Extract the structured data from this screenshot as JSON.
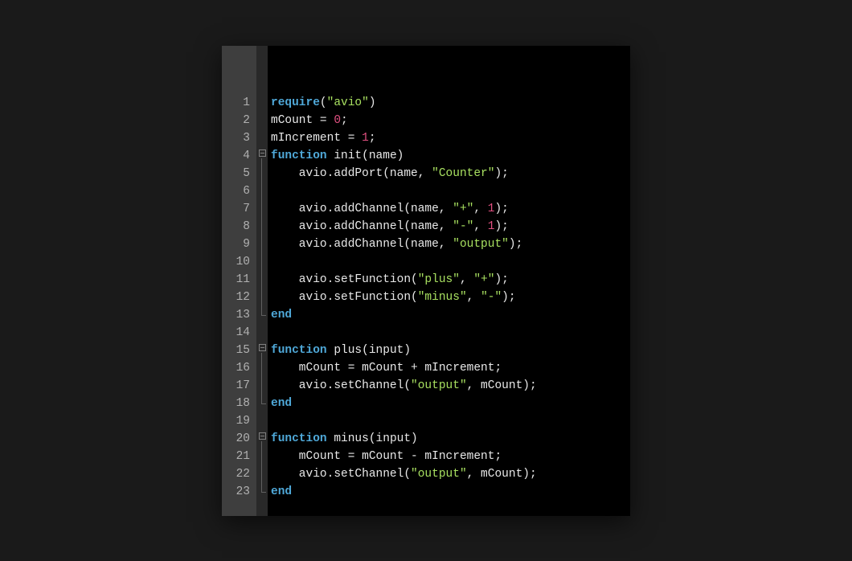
{
  "gutter": {
    "lines": [
      "1",
      "2",
      "3",
      "4",
      "5",
      "6",
      "7",
      "8",
      "9",
      "10",
      "11",
      "12",
      "13",
      "14",
      "15",
      "16",
      "17",
      "18",
      "19",
      "20",
      "21",
      "22",
      "23"
    ]
  },
  "code": {
    "lines": [
      [
        {
          "t": "keyword",
          "v": "require"
        },
        {
          "t": "punct",
          "v": "("
        },
        {
          "t": "string",
          "v": "\"avio\""
        },
        {
          "t": "punct",
          "v": ")"
        }
      ],
      [
        {
          "t": "ident",
          "v": "mCount = "
        },
        {
          "t": "number",
          "v": "0"
        },
        {
          "t": "punct",
          "v": ";"
        }
      ],
      [
        {
          "t": "ident",
          "v": "mIncrement = "
        },
        {
          "t": "number",
          "v": "1"
        },
        {
          "t": "punct",
          "v": ";"
        }
      ],
      [
        {
          "t": "keyword",
          "v": "function"
        },
        {
          "t": "ident",
          "v": " init(name)"
        }
      ],
      [
        {
          "t": "ident",
          "v": "    avio.addPort(name, "
        },
        {
          "t": "string",
          "v": "\"Counter\""
        },
        {
          "t": "punct",
          "v": ");"
        }
      ],
      [],
      [
        {
          "t": "ident",
          "v": "    avio.addChannel(name, "
        },
        {
          "t": "string",
          "v": "\"+\""
        },
        {
          "t": "punct",
          "v": ", "
        },
        {
          "t": "number",
          "v": "1"
        },
        {
          "t": "punct",
          "v": ");"
        }
      ],
      [
        {
          "t": "ident",
          "v": "    avio.addChannel(name, "
        },
        {
          "t": "string",
          "v": "\"-\""
        },
        {
          "t": "punct",
          "v": ", "
        },
        {
          "t": "number",
          "v": "1"
        },
        {
          "t": "punct",
          "v": ");"
        }
      ],
      [
        {
          "t": "ident",
          "v": "    avio.addChannel(name, "
        },
        {
          "t": "string",
          "v": "\"output\""
        },
        {
          "t": "punct",
          "v": ");"
        }
      ],
      [],
      [
        {
          "t": "ident",
          "v": "    avio.setFunction("
        },
        {
          "t": "string",
          "v": "\"plus\""
        },
        {
          "t": "punct",
          "v": ", "
        },
        {
          "t": "string",
          "v": "\"+\""
        },
        {
          "t": "punct",
          "v": ");"
        }
      ],
      [
        {
          "t": "ident",
          "v": "    avio.setFunction("
        },
        {
          "t": "string",
          "v": "\"minus\""
        },
        {
          "t": "punct",
          "v": ", "
        },
        {
          "t": "string",
          "v": "\"-\""
        },
        {
          "t": "punct",
          "v": ");"
        }
      ],
      [
        {
          "t": "keyword",
          "v": "end"
        }
      ],
      [],
      [
        {
          "t": "keyword",
          "v": "function"
        },
        {
          "t": "ident",
          "v": " plus(input)"
        }
      ],
      [
        {
          "t": "ident",
          "v": "    mCount = mCount + mIncrement;"
        }
      ],
      [
        {
          "t": "ident",
          "v": "    avio.setChannel("
        },
        {
          "t": "string",
          "v": "\"output\""
        },
        {
          "t": "punct",
          "v": ", mCount);"
        }
      ],
      [
        {
          "t": "keyword",
          "v": "end"
        }
      ],
      [],
      [
        {
          "t": "keyword",
          "v": "function"
        },
        {
          "t": "ident",
          "v": " minus(input)"
        }
      ],
      [
        {
          "t": "ident",
          "v": "    mCount = mCount - mIncrement;"
        }
      ],
      [
        {
          "t": "ident",
          "v": "    avio.setChannel("
        },
        {
          "t": "string",
          "v": "\"output\""
        },
        {
          "t": "punct",
          "v": ", mCount);"
        }
      ],
      [
        {
          "t": "keyword",
          "v": "end"
        }
      ]
    ]
  },
  "fold": {
    "markers": [
      {
        "line": 4,
        "type": "open"
      },
      {
        "line": 13,
        "type": "close"
      },
      {
        "line": 15,
        "type": "open"
      },
      {
        "line": 18,
        "type": "close"
      },
      {
        "line": 20,
        "type": "open"
      },
      {
        "line": 23,
        "type": "close"
      }
    ],
    "ranges": [
      {
        "from": 4,
        "to": 13
      },
      {
        "from": 15,
        "to": 18
      },
      {
        "from": 20,
        "to": 23
      }
    ]
  }
}
